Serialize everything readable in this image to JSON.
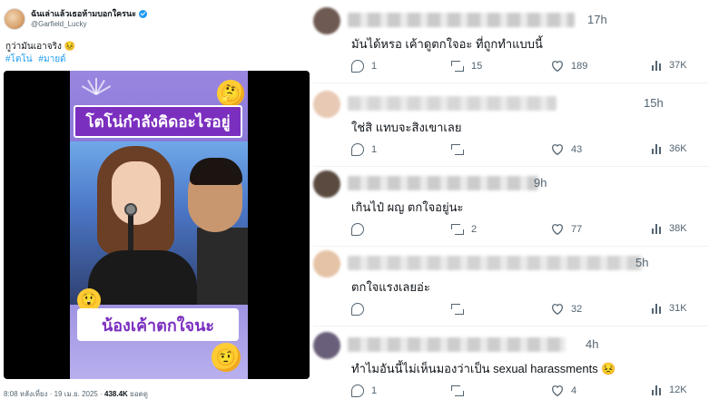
{
  "tweet": {
    "display_name": "ฉันเล่าแล้วเธอห้ามบอกใครนะ",
    "handle": "@Garfield_Lucky",
    "text": "กูว่ามันเอาจริง 😣",
    "hashtags": [
      "#โตโน่",
      "#มายด์"
    ],
    "media": {
      "caption_top": "โตโน่กำลังคิดอะไรอยู่",
      "caption_bottom": "น้องเค้าตกใจนะ",
      "emoji_think": "🤔",
      "emoji_shock": "😲",
      "emoji_smirk": "🤨"
    },
    "timestamp": "8:08 หลังเที่ยง · 19 เม.ย. 2025 ·",
    "views": "438.4K",
    "views_label": "ยอดดู"
  },
  "replies": [
    {
      "time": "17h",
      "text": "มันได้หรอ เค้าดูตกใจอะ ที่ถูกทำแบบนี้",
      "replies": "1",
      "retweets": "15",
      "likes": "189",
      "views": "37K",
      "name_color": "#b9b9b9",
      "avatar_color": "#6e5a52"
    },
    {
      "time": "15h",
      "text": "ใช่สิ แทบจะสิงเขาเลย",
      "replies": "1",
      "retweets": "",
      "likes": "43",
      "views": "36K",
      "name_color": "#c9c9c9",
      "avatar_color": "#e8c9b3"
    },
    {
      "time": "9h",
      "text": "เกินไป๋ ผญ ตกใจอยู่นะ",
      "replies": "",
      "retweets": "2",
      "likes": "77",
      "views": "38K",
      "name_color": "#bcbcbc",
      "avatar_color": "#5a4a40"
    },
    {
      "time": "5h",
      "text": "ตกใจแรงเลยอ่ะ",
      "replies": "",
      "retweets": "",
      "likes": "32",
      "views": "31K",
      "name_color": "#c4c4c4",
      "avatar_color": "#e5c3a6"
    },
    {
      "time": "4h",
      "text": "ทำไมอันนี้ไม่เห็นมองว่าเป็น sexual harassments 😣",
      "replies": "1",
      "retweets": "",
      "likes": "4",
      "views": "12K",
      "name_color": "#bdbdbd",
      "avatar_color": "#6a5f7a"
    }
  ],
  "icons": {
    "reply": "reply-icon",
    "retweet": "retweet-icon",
    "like": "heart-icon",
    "views": "views-icon",
    "verified": "verified-badge-icon"
  },
  "colors": {
    "accent": "#1d9bf0",
    "muted": "#536471",
    "caption_purple": "#7b2fbf"
  }
}
